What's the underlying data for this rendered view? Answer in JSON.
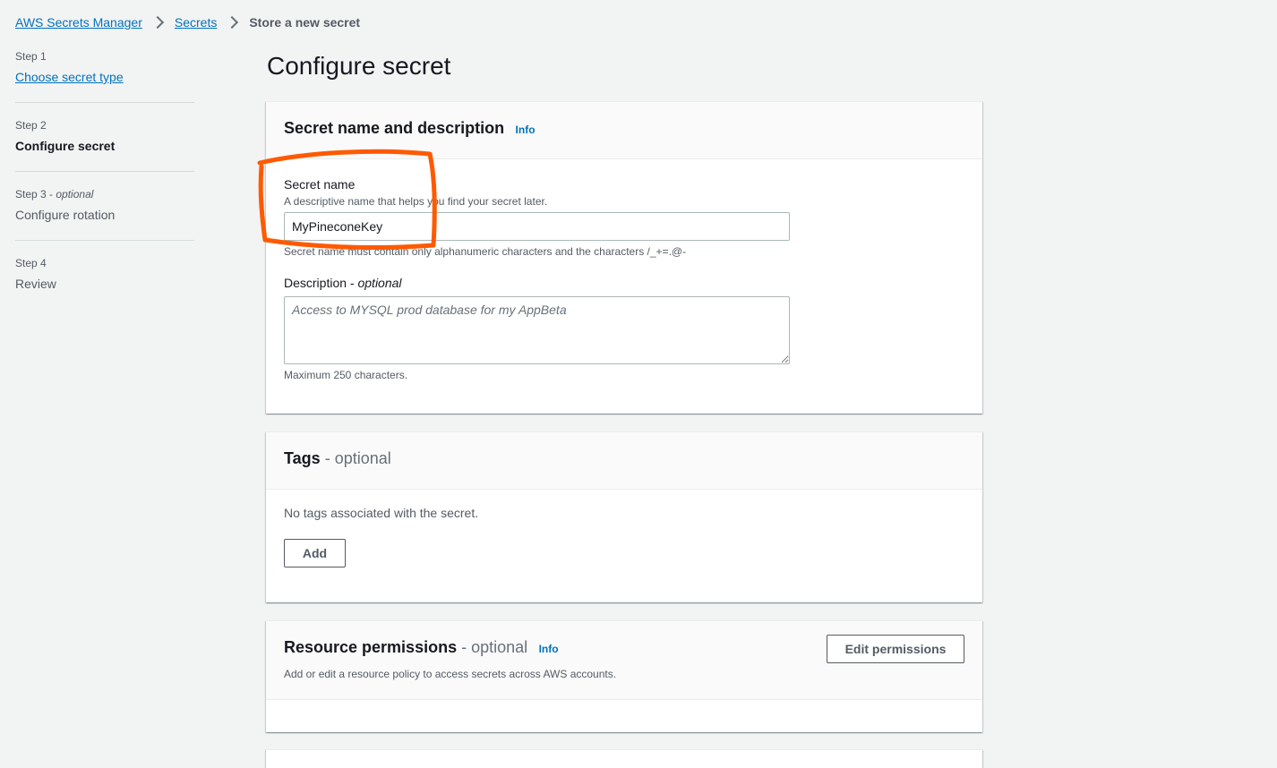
{
  "breadcrumb": {
    "items": [
      "AWS Secrets Manager",
      "Secrets"
    ],
    "current": "Store a new secret"
  },
  "steps": [
    {
      "num": "Step 1",
      "optional": "",
      "label": "Choose secret type"
    },
    {
      "num": "Step 2",
      "optional": "",
      "label": "Configure secret"
    },
    {
      "num": "Step 3",
      "optional": "optional",
      "label": "Configure rotation"
    },
    {
      "num": "Step 4",
      "optional": "",
      "label": "Review"
    }
  ],
  "page": {
    "title": "Configure secret"
  },
  "name_section": {
    "title": "Secret name and description",
    "info": "Info",
    "secret_name_label": "Secret name",
    "secret_name_desc": "A descriptive name that helps you find your secret later.",
    "secret_name_value": "MyPineconeKey",
    "secret_name_constraint": "Secret name must contain only alphanumeric characters and the characters /_+=.@-",
    "description_label": "Description",
    "description_optional": "optional",
    "description_placeholder": "Access to MYSQL prod database for my AppBeta",
    "description_constraint": "Maximum 250 characters."
  },
  "tags_section": {
    "title": "Tags",
    "optional": "optional",
    "empty_text": "No tags associated with the secret.",
    "add_label": "Add"
  },
  "permissions_section": {
    "title": "Resource permissions",
    "optional": "optional",
    "info": "Info",
    "description": "Add or edit a resource policy to access secrets across AWS accounts.",
    "edit_label": "Edit permissions"
  },
  "colors": {
    "link": "#0073bb",
    "annotation": "#ff5a00",
    "background": "#f2f3f3"
  }
}
